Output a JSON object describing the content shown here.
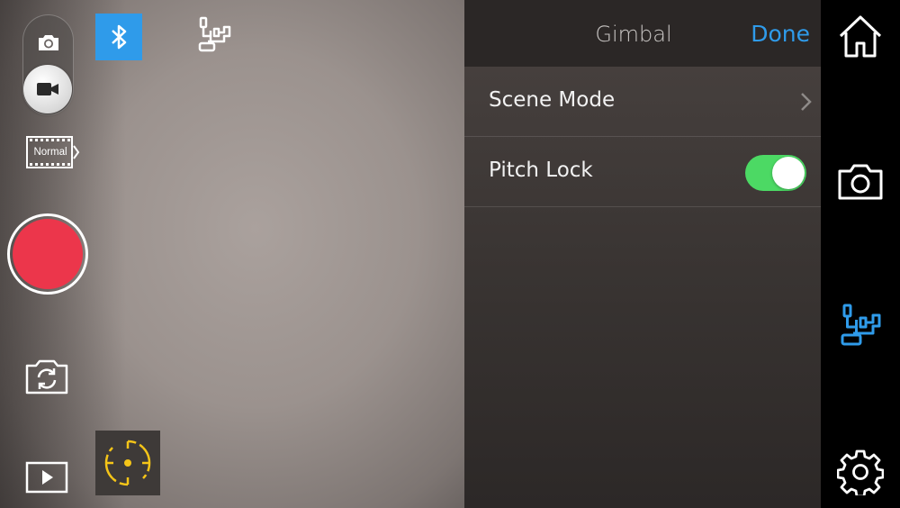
{
  "filter": {
    "label": "Normal"
  },
  "panel": {
    "title": "Gimbal",
    "done_label": "Done",
    "rows": [
      {
        "label": "Scene Mode",
        "control": "chevron"
      },
      {
        "label": "Pitch Lock",
        "control": "toggle",
        "toggle_on": true
      }
    ]
  },
  "nav": {
    "items": [
      {
        "name": "home-icon",
        "active": false
      },
      {
        "name": "camera-icon",
        "active": false
      },
      {
        "name": "gimbal-icon",
        "active": true
      },
      {
        "name": "gear-icon",
        "active": false
      }
    ]
  },
  "colors": {
    "accent": "#2f9bea",
    "record": "#ec364b",
    "toggle_on": "#4cd964",
    "tracking": "#f5c518"
  }
}
